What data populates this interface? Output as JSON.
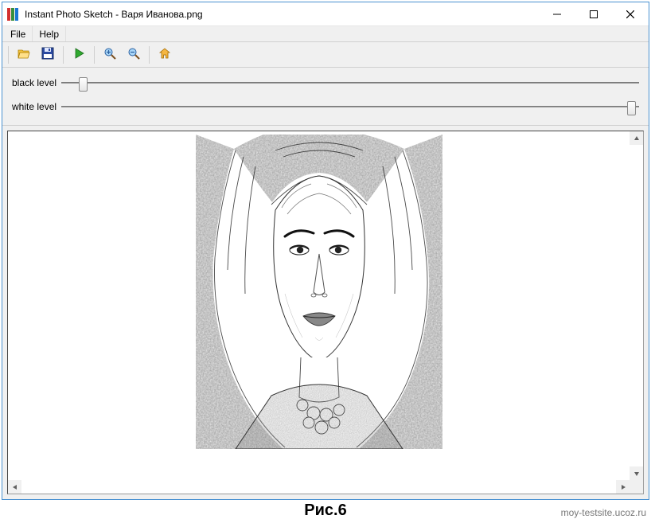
{
  "title": "Instant Photo Sketch - Варя Иванова.png",
  "menu": {
    "file": "File",
    "help": "Help"
  },
  "toolbar": {
    "open": "open",
    "save": "save",
    "run": "run",
    "zoom_in": "zoom-in",
    "zoom_out": "zoom-out",
    "home": "home"
  },
  "sliders": {
    "black_label": "black level",
    "black_value": 3,
    "white_label": "white level",
    "white_value": 98
  },
  "caption": "Рис.6",
  "watermark": "moy-testsite.ucoz.ru"
}
